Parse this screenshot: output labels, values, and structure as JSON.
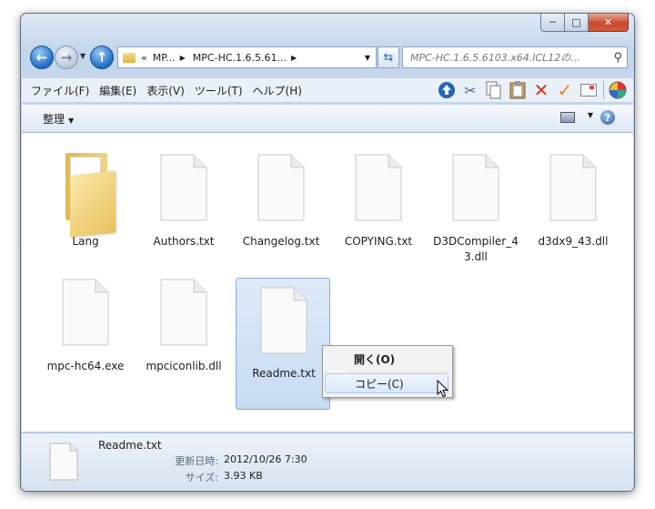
{
  "window": {
    "caption": {
      "minimize": "─",
      "maximize": "□",
      "close": "✕"
    }
  },
  "navigation": {
    "back_glyph": "←",
    "forward_glyph": "→",
    "up_glyph": "↑",
    "address": {
      "chevron": "«",
      "crumbs": [
        "MP...",
        "MPC-HC.1.6.5.61..."
      ]
    },
    "search": {
      "placeholder": "MPC-HC.1.6.5.6103.x64.ICL12の..."
    }
  },
  "menubar": {
    "items": [
      "ファイル(F)",
      "編集(E)",
      "表示(V)",
      "ツール(T)",
      "ヘルプ(H)"
    ],
    "toolbar_icons": [
      "up-arrow-icon",
      "scissors-icon",
      "copy-icon",
      "paste-icon",
      "delete-x-icon",
      "check-icon",
      "mail-icon",
      "properties-icon"
    ]
  },
  "commandbar": {
    "organize": "整理"
  },
  "files": [
    {
      "name": "Lang",
      "type": "folder"
    },
    {
      "name": "Authors.txt",
      "type": "file"
    },
    {
      "name": "Changelog.txt",
      "type": "file"
    },
    {
      "name": "COPYING.txt",
      "type": "file"
    },
    {
      "name": "D3DCompiler_43.dll",
      "type": "file"
    },
    {
      "name": "d3dx9_43.dll",
      "type": "file"
    },
    {
      "name": "mpc-hc64.exe",
      "type": "file"
    },
    {
      "name": "mpciconlib.dll",
      "type": "file"
    },
    {
      "name": "Readme.txt",
      "type": "file",
      "selected": true
    }
  ],
  "context_menu": {
    "open": "開く(O)",
    "copy": "コピー(C)"
  },
  "details": {
    "name": "Readme.txt",
    "modified_label": "更新日時:",
    "modified_value": "2012/10/26 7:30",
    "size_label": "サイズ:",
    "size_value": "3.93 KB"
  }
}
